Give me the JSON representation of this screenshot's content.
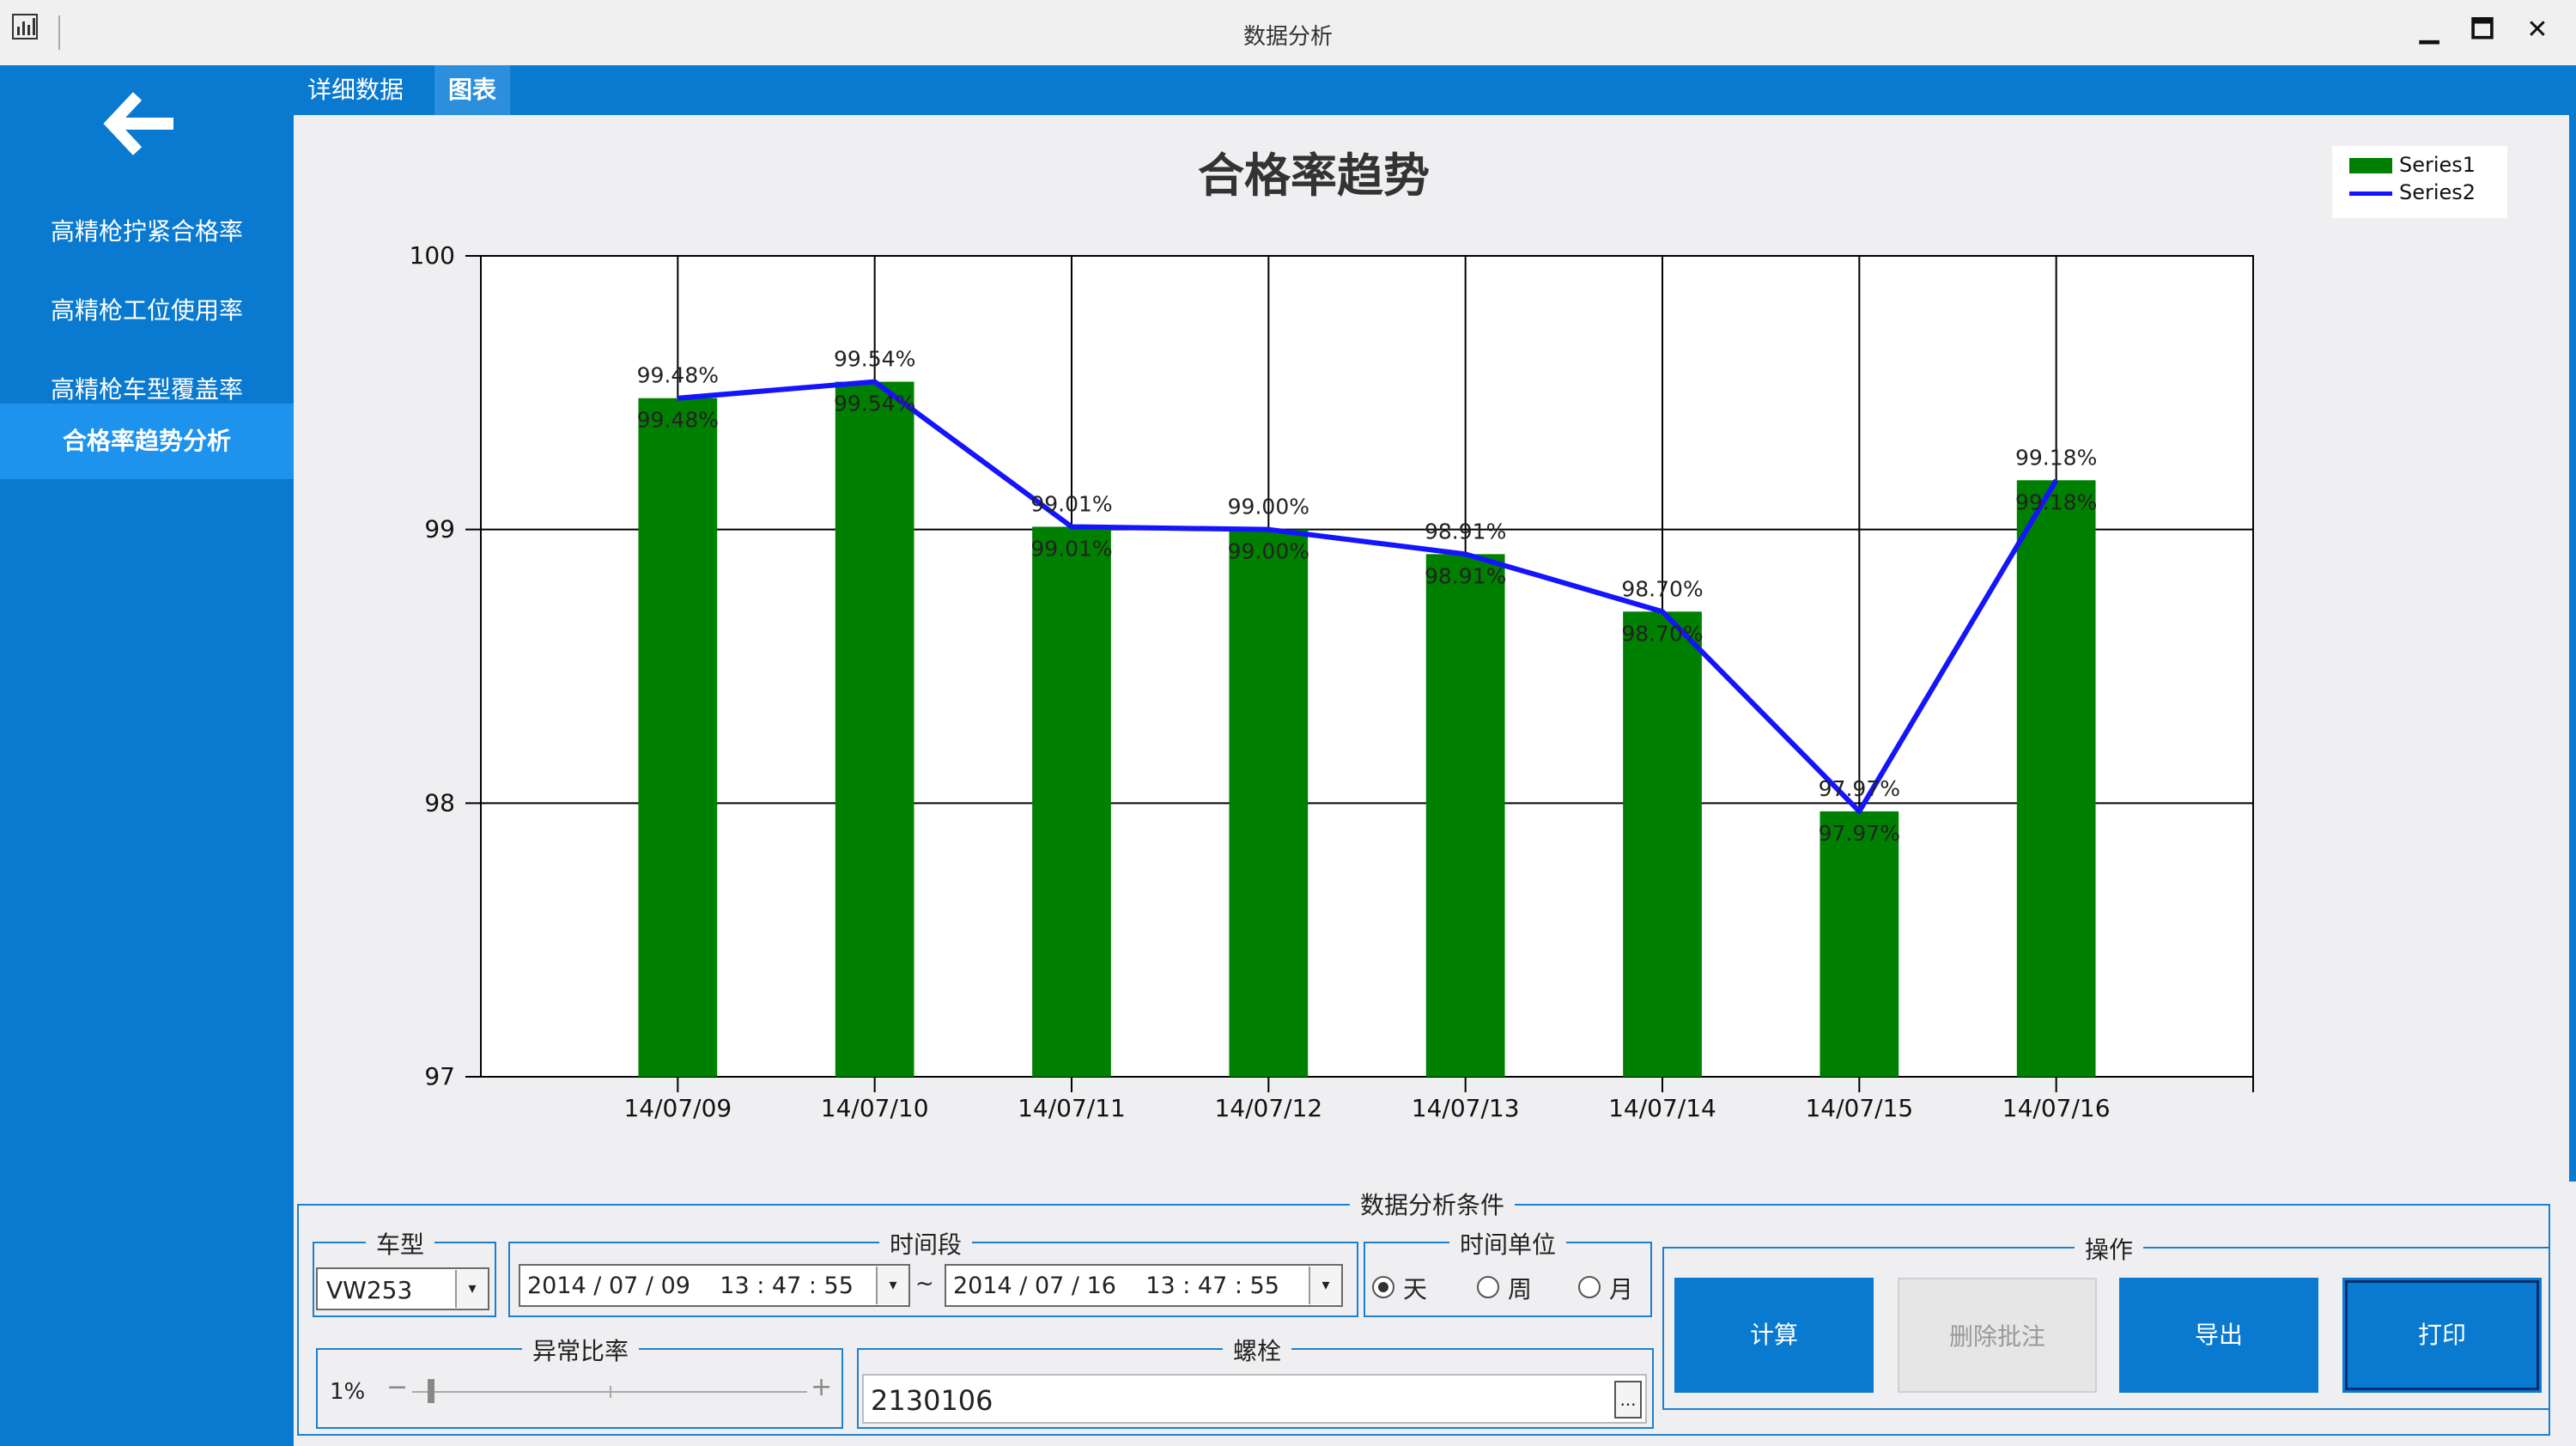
{
  "window": {
    "title": "数据分析",
    "minimize": "▁",
    "maximize": "🗖",
    "close": "✕"
  },
  "sidebar": {
    "items": [
      {
        "label": "高精枪拧紧合格率"
      },
      {
        "label": "高精枪工位使用率"
      },
      {
        "label": "高精枪车型覆盖率"
      },
      {
        "label": "合格率趋势分析",
        "active": true
      }
    ]
  },
  "tabs": [
    {
      "label": "详细数据"
    },
    {
      "label": "图表",
      "active": true
    }
  ],
  "chart_data": {
    "type": "bar",
    "title": "合格率趋势",
    "categories": [
      "14/07/09",
      "14/07/10",
      "14/07/11",
      "14/07/12",
      "14/07/13",
      "14/07/14",
      "14/07/15",
      "14/07/16"
    ],
    "series": [
      {
        "name": "Series1",
        "type": "bar",
        "color": "#008000",
        "values": [
          99.48,
          99.54,
          99.01,
          99.0,
          98.91,
          98.7,
          97.97,
          99.18
        ]
      },
      {
        "name": "Series2",
        "type": "line",
        "color": "#1414ff",
        "values": [
          99.48,
          99.54,
          99.01,
          99.0,
          98.91,
          98.7,
          97.97,
          99.18
        ]
      }
    ],
    "data_labels": [
      "99.48%",
      "99.54%",
      "99.01%",
      "99.00%",
      "98.91%",
      "98.70%",
      "97.97%",
      "99.18%"
    ],
    "ylim": [
      97,
      100
    ],
    "yticks": [
      "97",
      "98",
      "99",
      "100"
    ],
    "grid": true,
    "legend_position": "top-right"
  },
  "conditions": {
    "title": "数据分析条件",
    "vehicle": {
      "title": "车型",
      "value": "VW253"
    },
    "time_range": {
      "title": "时间段",
      "start": "2014 / 07 / 09    13 : 47 : 55",
      "separator": "~",
      "end": "2014 / 07 / 16    13 : 47 : 55"
    },
    "time_unit": {
      "title": "时间单位",
      "options": [
        {
          "label": "天",
          "selected": true
        },
        {
          "label": "周"
        },
        {
          "label": "月"
        }
      ]
    },
    "abnormal_ratio": {
      "title": "异常比率",
      "value_label": "1%",
      "minus": "−",
      "plus": "+",
      "level": 0.04
    },
    "bolt": {
      "title": "螺栓",
      "value": "2130106",
      "browse": "..."
    },
    "operations": {
      "title": "操作",
      "buttons": [
        {
          "label": "计算"
        },
        {
          "label": "删除批注",
          "disabled": true
        },
        {
          "label": "导出"
        },
        {
          "label": "打印",
          "focused": true
        }
      ]
    }
  }
}
